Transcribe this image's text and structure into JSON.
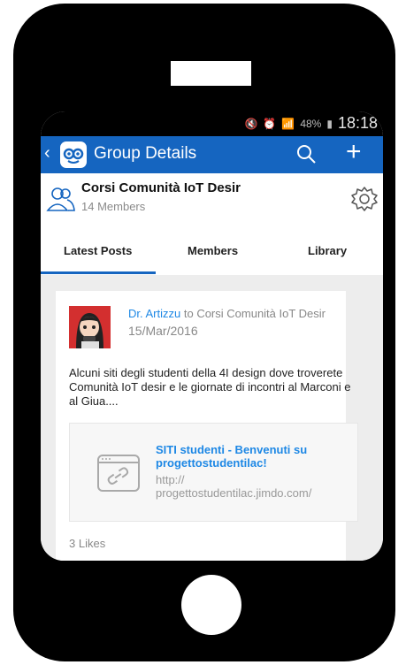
{
  "status": {
    "time": "18:18",
    "battery": "48%"
  },
  "appbar": {
    "back": "‹",
    "title": "Group Details",
    "plus": "+"
  },
  "group": {
    "name": "Corsi Comunità IoT Desir",
    "members": "14 Members"
  },
  "tabs": [
    {
      "label": "Latest Posts"
    },
    {
      "label": "Members"
    },
    {
      "label": "Library"
    }
  ],
  "post": {
    "author": "Dr. Artizzu",
    "to_text": " to Corsi Comunità IoT Desir",
    "date": "15/Mar/2016",
    "body": "Alcuni siti degli studenti della 4I design dove troverete Comunità IoT desir e le giornate di incontri al Marconi e al Giua....",
    "link": {
      "title": "SITI studenti - Benvenuti su progettostudentilac!",
      "url": "http://\nprogettostudentilac.jimdo.com/"
    },
    "likes": "3 Likes"
  },
  "colors": {
    "appbar": "#1565c0",
    "accent": "#1e88e5"
  }
}
